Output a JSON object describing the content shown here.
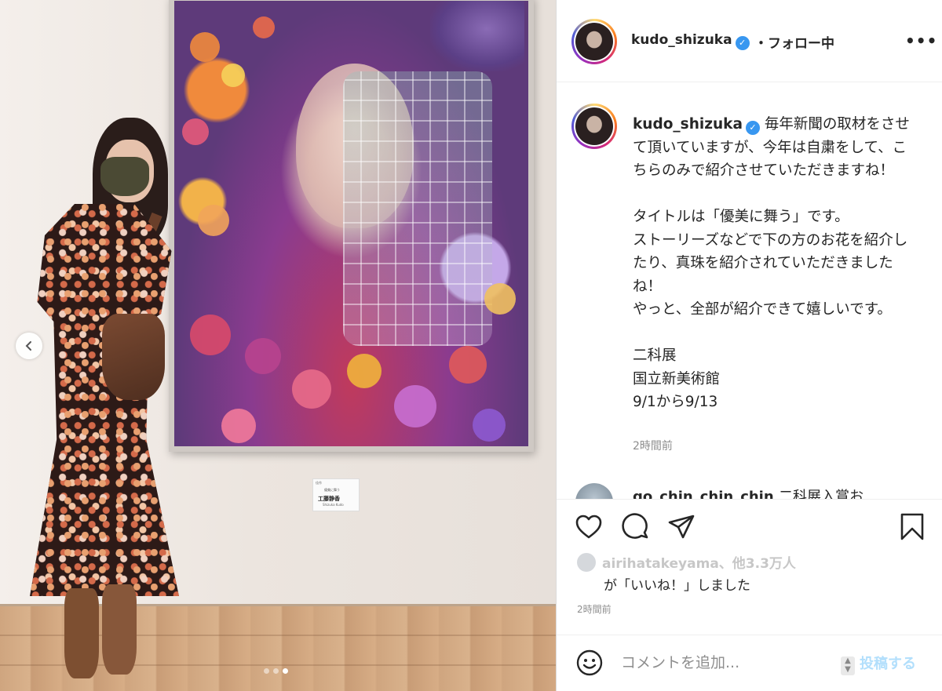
{
  "photo": {
    "placard": {
      "line1": "佳作",
      "line2": "優美に舞う",
      "artist": "工藤静香",
      "artist_romaji": "Shizuka Kudo"
    },
    "carousel": {
      "total": 3,
      "active_index": 2
    }
  },
  "header": {
    "username": "kudo_shizuka",
    "verified": true,
    "follow_status": "・フォロー中",
    "more_icon": "more-horizontal-icon"
  },
  "caption": {
    "username": "kudo_shizuka",
    "text": " 毎年新聞の取材をさせて頂いていますが、今年は自粛をして、こちらのみで紹介させていただきますね！\n\nタイトルは「優美に舞う」です。\nストーリーズなどで下の方のお花を紹介したり、真珠を紹介されていただきましたね！\nやっと、全部が紹介できて嬉しいです。\n\n二科展\n国立新美術館\n9/1から9/13",
    "time": "2時間前"
  },
  "comment_peek": {
    "username": "go_chin_chin_chin",
    "text": "二科展入賞お"
  },
  "actions": {
    "icons": [
      "heart-icon",
      "comment-icon",
      "share-icon",
      "bookmark-icon"
    ]
  },
  "likes": {
    "likers": "airihatakeyama、他3.3万人",
    "suffix": "が「いいね！」しました"
  },
  "post_time": "2時間前",
  "comment_box": {
    "placeholder": "コメントを追加...",
    "post_label": "投稿する"
  },
  "colors": {
    "accent": "#3897f0",
    "post_disabled": "#b2dffc",
    "meta_text": "#8e8e8e"
  }
}
